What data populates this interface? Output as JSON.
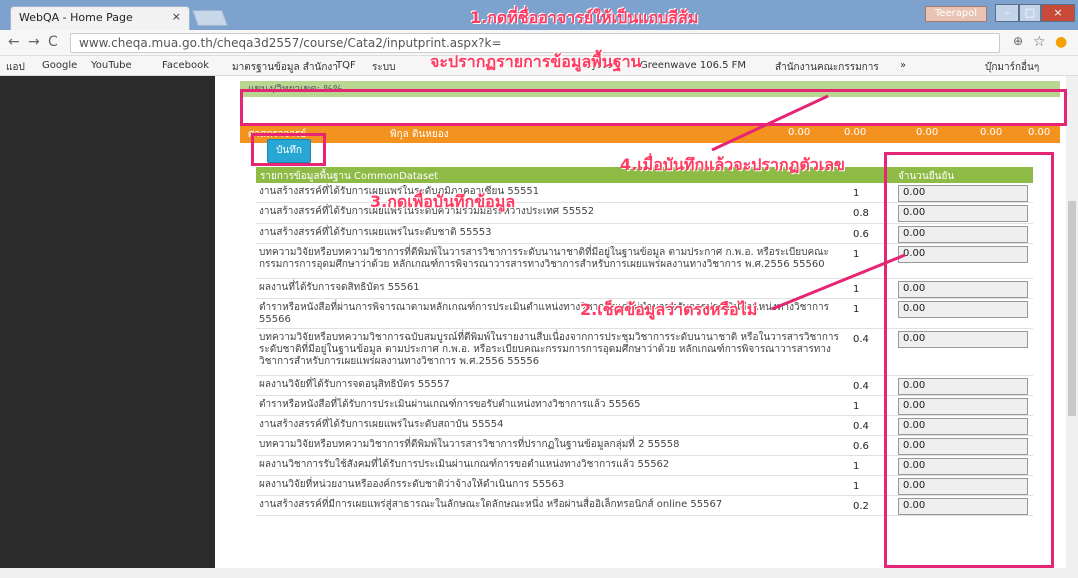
{
  "browser": {
    "tab_title": "WebQA - Home Page",
    "tab_close": "×",
    "user": "Teerapol",
    "url": "www.cheqa.mua.go.th/cheqa3d2557/course/Cata2/inputprint.aspx?k=",
    "bookmarks": [
      "แอป",
      "Google",
      "YouTube",
      "Facebook",
      "มาตรฐานข้อมูล สำนักงา",
      "TQF",
      "ระบบ",
      "Syste",
      "Greenwave 106.5 FM",
      "สำนักงานคณะกรรมการ",
      "»",
      "บุ๊กมาร์กอื่นๆ"
    ]
  },
  "header": {
    "label": "แขนง/วิทยาเขต: %%",
    "instructor_title": "ศาสตราจารย์",
    "instructor_name": "พิกุล ดินหยอง",
    "values": [
      "0.00",
      "0.00",
      "0.00",
      "0.00",
      "0.00"
    ]
  },
  "save_button": "บันทึก",
  "table": {
    "columns": [
      "รายการข้อมูลพื้นฐาน CommonDataset",
      "จำนวนยืนยัน"
    ],
    "rows": [
      {
        "name": "งานสร้างสรรค์ที่ได้รับการเผยแพร่ในระดับภูมิภาคอาเซียน 55551",
        "factor": "1",
        "value": "0.00"
      },
      {
        "name": "งานสร้างสรรค์ที่ได้รับการเผยแพร่ในระดับความร่วมมือระหว่างประเทศ 55552",
        "factor": "0.8",
        "value": "0.00"
      },
      {
        "name": "งานสร้างสรรค์ที่ได้รับการเผยแพร่ในระดับชาติ 55553",
        "factor": "0.6",
        "value": "0.00"
      },
      {
        "name": "บทความวิจัยหรือบทความวิชาการที่ตีพิมพ์ในวารสารวิชาการระดับนานาชาติที่มีอยู่ในฐานข้อมูล ตามประกาศ ก.พ.อ. หรือระเบียบคณะกรรมการการอุดมศึกษาว่าด้วย หลักเกณฑ์การพิจารณาวารสารทางวิชาการสำหรับการเผยแพร่ผลงานทางวิชาการ พ.ศ.2556 55560",
        "factor": "1",
        "value": "0.00"
      },
      {
        "name": "ผลงานที่ได้รับการจดสิทธิบัตร 55561",
        "factor": "1",
        "value": "0.00"
      },
      {
        "name": "ตำราหรือหนังสือที่ผ่านการพิจารณาตามหลักเกณฑ์การประเมินตำแหน่งทางวิชาการแต่ไม่นำมาขอรับการประเมินตำแหน่งทางวิชาการ 55566",
        "factor": "1",
        "value": "0.00"
      },
      {
        "name": "บทความวิจัยหรือบทความวิชาการฉบับสมบูรณ์ที่ตีพิมพ์ในรายงานสืบเนื่องจากการประชุมวิชาการระดับนานาชาติ หรือในวารสารวิชาการระดับชาติที่มีอยู่ในฐานข้อมูล ตามประกาศ ก.พ.อ. หรือระเบียบคณะกรรมการการอุดมศึกษาว่าด้วย หลักเกณฑ์การพิจารณาวารสารทางวิชาการสำหรับการเผยแพร่ผลงานทางวิชาการ พ.ศ.2556 55556",
        "factor": "0.4",
        "value": "0.00"
      },
      {
        "name": "ผลงานวิจัยที่ได้รับการจดอนุสิทธิบัตร 55557",
        "factor": "0.4",
        "value": "0.00"
      },
      {
        "name": "ตำราหรือหนังสือที่ได้รับการประเมินผ่านเกณฑ์การขอรับตำแหน่งทางวิชาการแล้ว 55565",
        "factor": "1",
        "value": "0.00"
      },
      {
        "name": "งานสร้างสรรค์ที่ได้รับการเผยแพร่ในระดับสถาบัน 55554",
        "factor": "0.4",
        "value": "0.00"
      },
      {
        "name": "บทความวิจัยหรือบทความวิชาการที่ตีพิมพ์ในวารสารวิชาการที่ปรากฏในฐานข้อมูลกลุ่มที่ 2 55558",
        "factor": "0.6",
        "value": "0.00"
      },
      {
        "name": "ผลงานวิชาการรับใช้สังคมที่ได้รับการประเมินผ่านเกณฑ์การขอตำแหน่งทางวิชาการแล้ว 55562",
        "factor": "1",
        "value": "0.00"
      },
      {
        "name": "ผลงานวิจัยที่หน่วยงานหรือองค์กรระดับชาติว่าจ้างให้ดำเนินการ 55563",
        "factor": "1",
        "value": "0.00"
      },
      {
        "name": "งานสร้างสรรค์ที่มีการเผยแพร่สู่สาธารณะในลักษณะใดลักษณะหนึ่ง หรือผ่านสื่ออิเล็กทรอนิกส์ online 55567",
        "factor": "0.2",
        "value": "0.00"
      }
    ]
  },
  "annotations": {
    "a1": "1.กดที่ชื่ออาจารย์ให้เป็นแถบสีส้ม",
    "a1b": "จะปรากฏรายการข้อมูลพื้นฐาน",
    "a2": "2.เช็คข้อมูลว่าตรงหรือไม่",
    "a3": "3.กดเพื่อบันทึกข้อมูล",
    "a4": "4.เมื่อบันทึกแล้วจะปรากฏตัวเลข"
  }
}
